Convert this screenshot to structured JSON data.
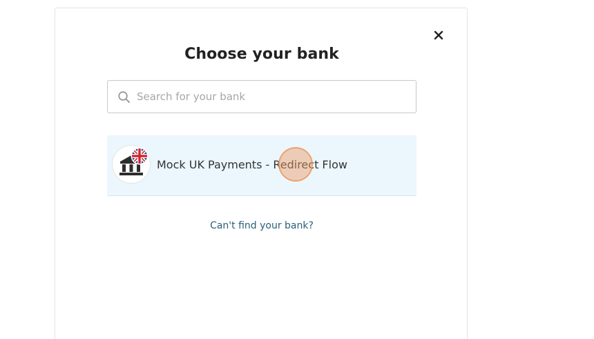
{
  "modal": {
    "title": "Choose your bank",
    "close_icon": "close-icon"
  },
  "search": {
    "placeholder": "Search for your bank",
    "value": "",
    "icon": "search-icon"
  },
  "banks": [
    {
      "name": "Mock UK Payments - Redirect Flow",
      "icon": "bank-building-icon",
      "badge": "uk-flag-icon"
    }
  ],
  "cant_find_link": "Can't find your bank?",
  "colors": {
    "title": "#222222",
    "row_background": "#ebf6fd",
    "link": "#2b5f78",
    "click_marker": "#ee9a60"
  }
}
